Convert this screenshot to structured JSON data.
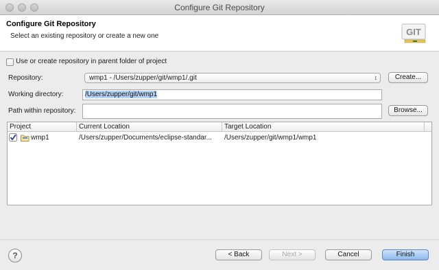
{
  "window": {
    "title": "Configure Git Repository"
  },
  "header": {
    "title": "Configure Git Repository",
    "subtitle": "Select an existing repository or create a new one",
    "logo_text": "GIT"
  },
  "options": {
    "parent_folder_label": "Use or create repository in parent folder of project",
    "parent_folder_checked": false
  },
  "repository": {
    "label": "Repository:",
    "value": "wmp1 - /Users/zupper/git/wmp1/.git",
    "create_label": "Create..."
  },
  "working_dir": {
    "label": "Working directory:",
    "value": "/Users/zupper/git/wmp1"
  },
  "path_within": {
    "label": "Path within repository:",
    "value": "",
    "browse_label": "Browse..."
  },
  "table": {
    "headers": [
      "Project",
      "Current Location",
      "Target Location"
    ],
    "rows": [
      {
        "checked": true,
        "project": "wmp1",
        "current": "/Users/zupper/Documents/eclipse-standar...",
        "target": "/Users/zupper/git/wmp1/wmp1"
      }
    ]
  },
  "footer": {
    "help_symbol": "?",
    "back_label": "< Back",
    "next_label": "Next >",
    "cancel_label": "Cancel",
    "finish_label": "Finish"
  },
  "colors": {
    "accent": "#8db8ee",
    "selection": "#b5d3f6"
  }
}
